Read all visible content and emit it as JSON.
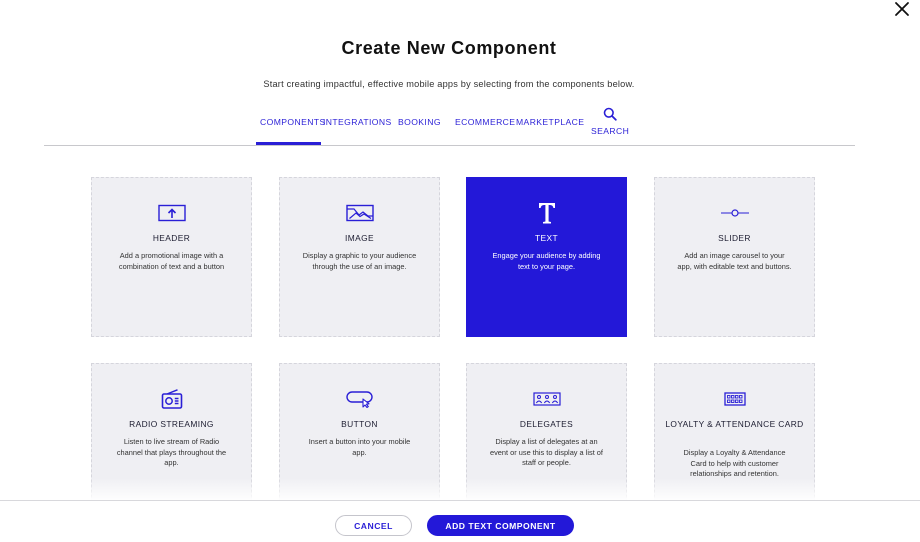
{
  "dialog": {
    "title": "Create New Component",
    "subtitle": "Start creating impactful, effective mobile apps by selecting from the components below."
  },
  "tabs": [
    {
      "label": "COMPONENTS",
      "active": true
    },
    {
      "label": "INTEGRATIONS",
      "active": false
    },
    {
      "label": "BOOKING",
      "active": false
    },
    {
      "label": "ECOMMERCE",
      "active": false
    },
    {
      "label": "MARKETPLACE",
      "active": false
    },
    {
      "label": "SEARCH",
      "active": false,
      "icon": "search-icon"
    }
  ],
  "components": [
    {
      "name": "HEADER",
      "description": "Add a promotional image with a combination of text and a button",
      "icon": "header-icon"
    },
    {
      "name": "IMAGE",
      "description": "Display a graphic to your audience through the use of an image.",
      "icon": "image-icon"
    },
    {
      "name": "TEXT",
      "description": "Engage your audience by adding text to your page.",
      "icon": "text-icon",
      "selected": true
    },
    {
      "name": "SLIDER",
      "description": "Add an image carousel to your app, with editable text and buttons.",
      "icon": "slider-icon"
    },
    {
      "name": "RADIO STREAMING",
      "description": "Listen to live stream of Radio channel that plays throughout the app.",
      "icon": "radio-icon"
    },
    {
      "name": "BUTTON",
      "description": "Insert a button into your mobile app.",
      "icon": "button-icon"
    },
    {
      "name": "DELEGATES",
      "description": "Display a list of delegates at an event or use this to display a list of staff or people.",
      "icon": "delegates-icon"
    },
    {
      "name": "LOYALTY & ATTENDANCE CARD",
      "description": "Display a Loyalty & Attendance Card to help with customer relationships and retention.",
      "icon": "loyalty-card-icon"
    }
  ],
  "footer": {
    "cancel_label": "CANCEL",
    "add_label": "ADD TEXT COMPONENT"
  },
  "colors": {
    "accent": "#2318d8",
    "card_bg": "#efeff3"
  }
}
